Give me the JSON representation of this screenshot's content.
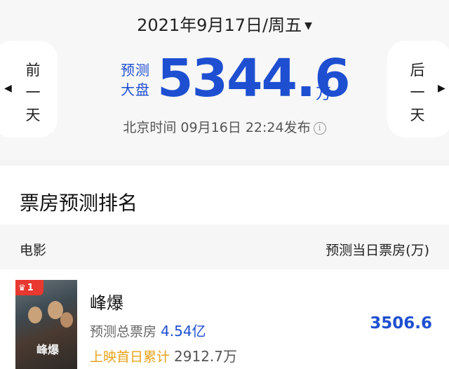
{
  "header": {
    "date": "2021年9月17日/周五",
    "prev_day": [
      "前",
      "一",
      "天"
    ],
    "next_day": [
      "后",
      "一",
      "天"
    ],
    "prediction_label": [
      "预测",
      "大盘"
    ],
    "prediction_value": "5344.6",
    "prediction_unit": "万",
    "publish_time": "北京时间 09月16日 22:24发布"
  },
  "ranking": {
    "title": "票房预测排名",
    "col_movie": "电影",
    "col_value": "预测当日票房(万)",
    "movies": [
      {
        "rank": "1",
        "poster_title": "峰爆",
        "name": "峰爆",
        "total_label": "预测总票房",
        "total_value": "4.54亿",
        "first_day_label": "上映首日累计",
        "first_day_value": "2912.7万",
        "day_value": "3506.6"
      }
    ]
  },
  "colors": {
    "accent": "#1e4fd1",
    "highlight": "#e8a21a",
    "badge": "#e8382f"
  }
}
